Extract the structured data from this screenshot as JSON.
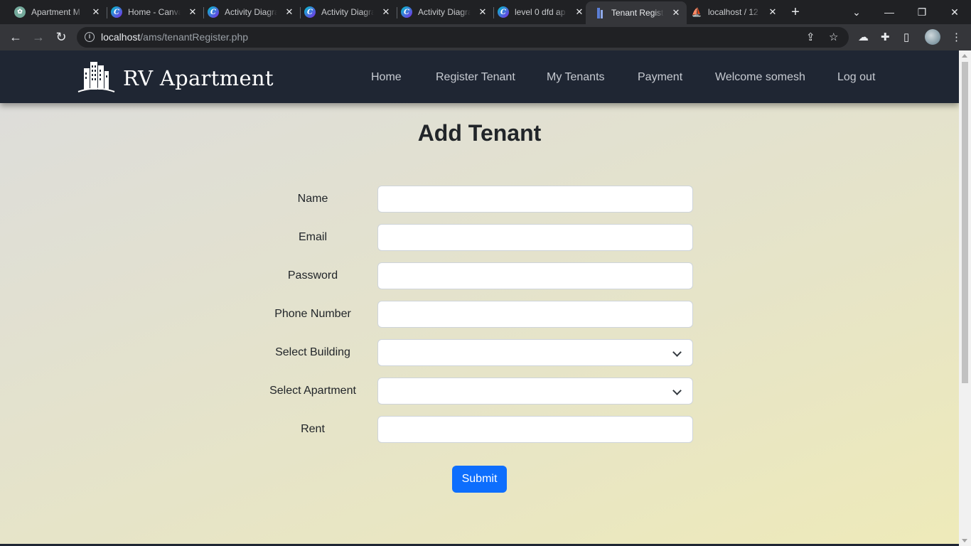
{
  "browser": {
    "tabs": [
      {
        "title": "Apartment M",
        "icon": "chatgpt-icon",
        "active": false
      },
      {
        "title": "Home - Canva",
        "icon": "canva-icon",
        "active": false
      },
      {
        "title": "Activity Diagram",
        "icon": "canva-icon",
        "active": false
      },
      {
        "title": "Activity Diagram",
        "icon": "canva-icon",
        "active": false
      },
      {
        "title": "Activity Diagram",
        "icon": "canva-icon",
        "active": false
      },
      {
        "title": "level 0 dfd ap",
        "icon": "canva-icon",
        "active": false
      },
      {
        "title": "Tenant Register",
        "icon": "building-icon",
        "active": true
      },
      {
        "title": "localhost / 12",
        "icon": "phpmyadmin-icon",
        "active": false
      }
    ],
    "url_host": "localhost",
    "url_path": "/ams/tenantRegister.php"
  },
  "site": {
    "brand": "RV Apartment",
    "nav": [
      "Home",
      "Register Tenant",
      "My Tenants",
      "Payment",
      "Welcome somesh",
      "Log out"
    ]
  },
  "form": {
    "title": "Add Tenant",
    "fields": [
      {
        "label": "Name",
        "type": "text",
        "value": ""
      },
      {
        "label": "Email",
        "type": "email",
        "value": ""
      },
      {
        "label": "Password",
        "type": "password",
        "value": ""
      },
      {
        "label": "Phone Number",
        "type": "tel",
        "value": ""
      },
      {
        "label": "Select Building",
        "type": "select",
        "value": ""
      },
      {
        "label": "Select Apartment",
        "type": "select",
        "value": ""
      },
      {
        "label": "Rent",
        "type": "text",
        "value": ""
      }
    ],
    "submit_label": "Submit"
  },
  "colors": {
    "navbar": "#1f2633",
    "primary": "#0d6efd"
  }
}
